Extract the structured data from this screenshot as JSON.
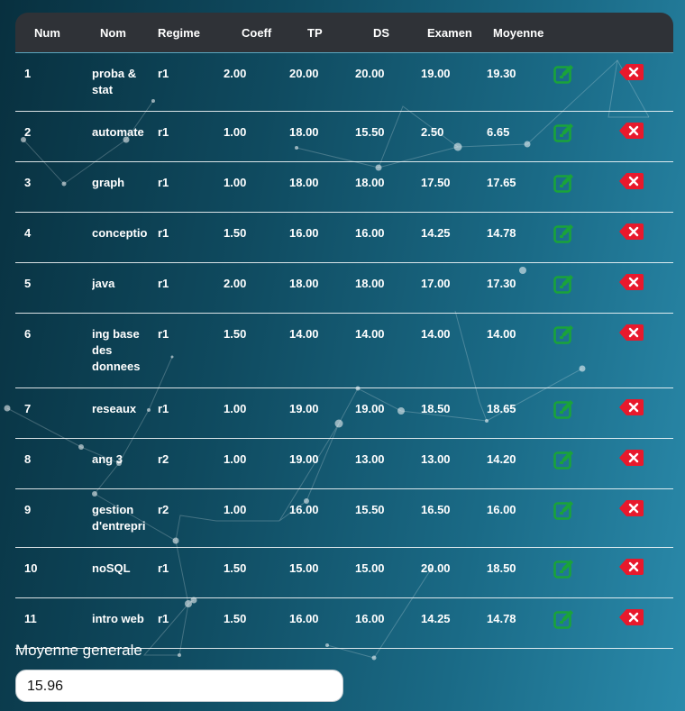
{
  "table": {
    "headers": {
      "num": "Num",
      "nom": "Nom",
      "regime": "Regime",
      "coeff": "Coeff",
      "tp": "TP",
      "ds": "DS",
      "examen": "Examen",
      "moyenne": "Moyenne"
    },
    "rows": [
      {
        "num": "1",
        "nom": "proba & stat",
        "regime": "r1",
        "coeff": "2.00",
        "tp": "20.00",
        "ds": "20.00",
        "examen": "19.00",
        "moyenne": "19.30"
      },
      {
        "num": "2",
        "nom": "automate",
        "regime": "r1",
        "coeff": "1.00",
        "tp": "18.00",
        "ds": "15.50",
        "examen": "2.50",
        "moyenne": "6.65"
      },
      {
        "num": "3",
        "nom": "graph",
        "regime": "r1",
        "coeff": "1.00",
        "tp": "18.00",
        "ds": "18.00",
        "examen": "17.50",
        "moyenne": "17.65"
      },
      {
        "num": "4",
        "nom": "conceptio",
        "regime": "r1",
        "coeff": "1.50",
        "tp": "16.00",
        "ds": "16.00",
        "examen": "14.25",
        "moyenne": "14.78"
      },
      {
        "num": "5",
        "nom": "java",
        "regime": "r1",
        "coeff": "2.00",
        "tp": "18.00",
        "ds": "18.00",
        "examen": "17.00",
        "moyenne": "17.30"
      },
      {
        "num": "6",
        "nom": "ing base des donnees",
        "regime": "r1",
        "coeff": "1.50",
        "tp": "14.00",
        "ds": "14.00",
        "examen": "14.00",
        "moyenne": "14.00"
      },
      {
        "num": "7",
        "nom": "reseaux",
        "regime": "r1",
        "coeff": "1.00",
        "tp": "19.00",
        "ds": "19.00",
        "examen": "18.50",
        "moyenne": "18.65"
      },
      {
        "num": "8",
        "nom": "ang 3",
        "regime": "r2",
        "coeff": "1.00",
        "tp": "19.00",
        "ds": "13.00",
        "examen": "13.00",
        "moyenne": "14.20"
      },
      {
        "num": "9",
        "nom": "gestion d'entrepri",
        "regime": "r2",
        "coeff": "1.00",
        "tp": "16.00",
        "ds": "15.50",
        "examen": "16.50",
        "moyenne": "16.00"
      },
      {
        "num": "10",
        "nom": "noSQL",
        "regime": "r1",
        "coeff": "1.50",
        "tp": "15.00",
        "ds": "15.00",
        "examen": "20.00",
        "moyenne": "18.50"
      },
      {
        "num": "11",
        "nom": "intro web",
        "regime": "r1",
        "coeff": "1.50",
        "tp": "16.00",
        "ds": "16.00",
        "examen": "14.25",
        "moyenne": "14.78"
      }
    ],
    "icons": {
      "edit": "edit-icon",
      "delete": "delete-icon"
    }
  },
  "footer": {
    "label": "Moyenne generale",
    "value": "15.96"
  },
  "colors": {
    "header_bg": "#2f3237",
    "edit_green": "#1aa33a",
    "delete_red": "#e8192c",
    "bg_dark": "#08303f",
    "bg_light": "#2a8aab"
  }
}
